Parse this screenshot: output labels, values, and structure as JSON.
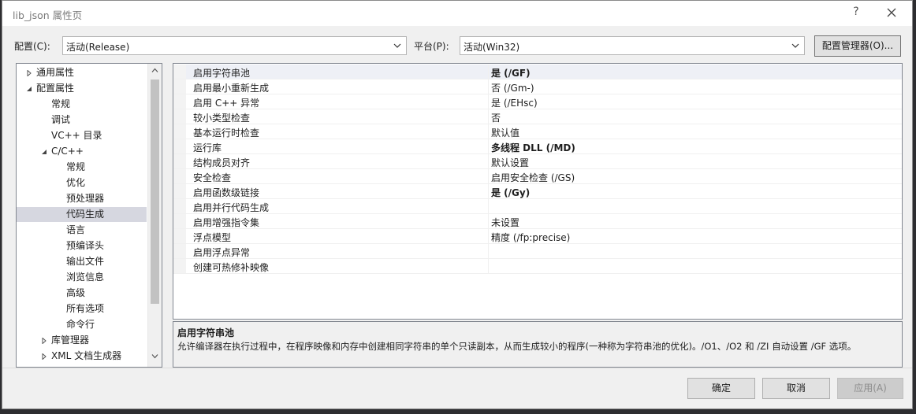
{
  "window": {
    "title": "lib_json 属性页",
    "help": "?"
  },
  "toolbar": {
    "config_label": "配置(C):",
    "config_value": "活动(Release)",
    "platform_label": "平台(P):",
    "platform_value": "活动(Win32)",
    "config_manager": "配置管理器(O)..."
  },
  "tree": [
    {
      "label": "通用属性",
      "indent": 0,
      "expander": "collapsed",
      "selected": false
    },
    {
      "label": "配置属性",
      "indent": 0,
      "expander": "expanded",
      "selected": false
    },
    {
      "label": "常规",
      "indent": 1,
      "expander": "none",
      "selected": false
    },
    {
      "label": "调试",
      "indent": 1,
      "expander": "none",
      "selected": false
    },
    {
      "label": "VC++ 目录",
      "indent": 1,
      "expander": "none",
      "selected": false
    },
    {
      "label": "C/C++",
      "indent": 1,
      "expander": "expanded",
      "selected": false
    },
    {
      "label": "常规",
      "indent": 2,
      "expander": "none",
      "selected": false
    },
    {
      "label": "优化",
      "indent": 2,
      "expander": "none",
      "selected": false
    },
    {
      "label": "预处理器",
      "indent": 2,
      "expander": "none",
      "selected": false
    },
    {
      "label": "代码生成",
      "indent": 2,
      "expander": "none",
      "selected": true
    },
    {
      "label": "语言",
      "indent": 2,
      "expander": "none",
      "selected": false
    },
    {
      "label": "预编译头",
      "indent": 2,
      "expander": "none",
      "selected": false
    },
    {
      "label": "输出文件",
      "indent": 2,
      "expander": "none",
      "selected": false
    },
    {
      "label": "浏览信息",
      "indent": 2,
      "expander": "none",
      "selected": false
    },
    {
      "label": "高级",
      "indent": 2,
      "expander": "none",
      "selected": false
    },
    {
      "label": "所有选项",
      "indent": 2,
      "expander": "none",
      "selected": false
    },
    {
      "label": "命令行",
      "indent": 2,
      "expander": "none",
      "selected": false
    },
    {
      "label": "库管理器",
      "indent": 1,
      "expander": "collapsed",
      "selected": false
    },
    {
      "label": "XML 文档生成器",
      "indent": 1,
      "expander": "collapsed",
      "selected": false
    }
  ],
  "properties": [
    {
      "name": "启用字符串池",
      "value": "是 (/GF)",
      "bold": true,
      "selected": true
    },
    {
      "name": "启用最小重新生成",
      "value": "否 (/Gm-)",
      "bold": false,
      "selected": false
    },
    {
      "name": "启用 C++ 异常",
      "value": "是 (/EHsc)",
      "bold": false,
      "selected": false
    },
    {
      "name": "较小类型检查",
      "value": "否",
      "bold": false,
      "selected": false
    },
    {
      "name": "基本运行时检查",
      "value": "默认值",
      "bold": false,
      "selected": false
    },
    {
      "name": "运行库",
      "value": "多线程 DLL (/MD)",
      "bold": true,
      "selected": false
    },
    {
      "name": "结构成员对齐",
      "value": "默认设置",
      "bold": false,
      "selected": false
    },
    {
      "name": "安全检查",
      "value": "启用安全检查 (/GS)",
      "bold": false,
      "selected": false
    },
    {
      "name": "启用函数级链接",
      "value": "是 (/Gy)",
      "bold": true,
      "selected": false
    },
    {
      "name": "启用并行代码生成",
      "value": "",
      "bold": false,
      "selected": false
    },
    {
      "name": "启用增强指令集",
      "value": "未设置",
      "bold": false,
      "selected": false
    },
    {
      "name": "浮点模型",
      "value": "精度 (/fp:precise)",
      "bold": false,
      "selected": false
    },
    {
      "name": "启用浮点异常",
      "value": "",
      "bold": false,
      "selected": false
    },
    {
      "name": "创建可热修补映像",
      "value": "",
      "bold": false,
      "selected": false
    }
  ],
  "description": {
    "title": "启用字符串池",
    "text": "允许编译器在执行过程中，在程序映像和内存中创建相同字符串的单个只读副本，从而生成较小的程序(一种称为字符串池的优化)。/O1、/O2 和 /ZI 自动设置 /GF 选项。"
  },
  "buttons": {
    "ok": "确定",
    "cancel": "取消",
    "apply": "应用(A)"
  },
  "colors": {
    "selection": "#d6d7e0",
    "disabled_text": "#8d8d8d"
  }
}
